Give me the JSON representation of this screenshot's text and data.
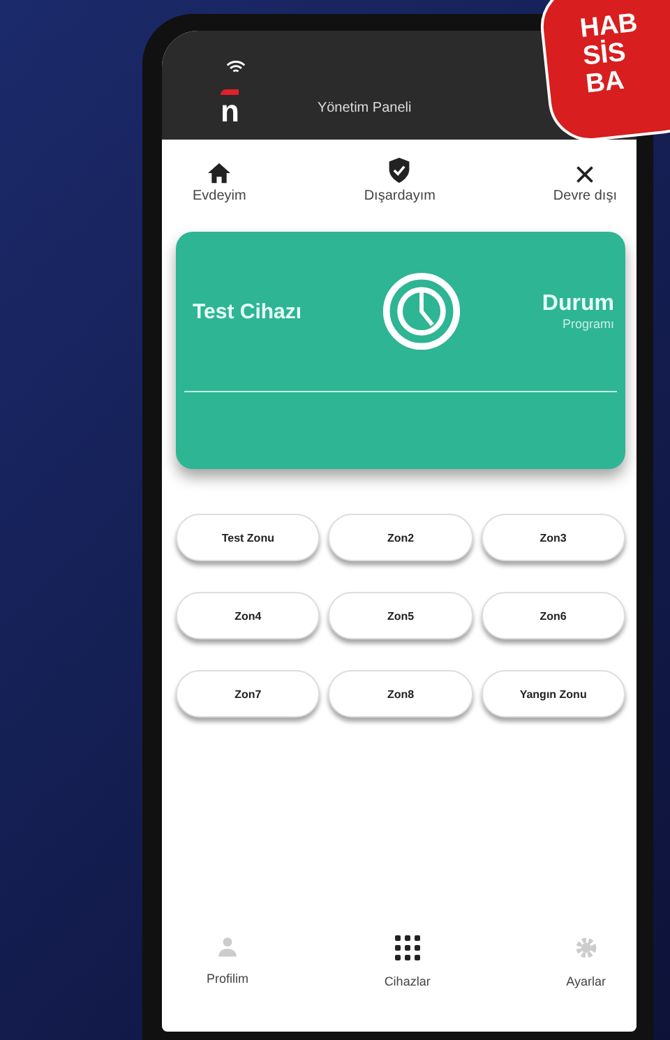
{
  "badge": {
    "lines": [
      "HAB",
      "SİS",
      "BA"
    ]
  },
  "header": {
    "logo": "n",
    "title": "Yönetim Paneli"
  },
  "modes": [
    {
      "label": "Evdeyim",
      "kind": "home"
    },
    {
      "label": "Dışardayım",
      "kind": "shield"
    },
    {
      "label": "Devre dışı",
      "kind": "close"
    }
  ],
  "device_card": {
    "name": "Test Cihazı",
    "status": "Durum",
    "status_detail": "Programı"
  },
  "zones": [
    "Test Zonu",
    "Zon2",
    "Zon3",
    "Zon4",
    "Zon5",
    "Zon6",
    "Zon7",
    "Zon8",
    "Yangın Zonu"
  ],
  "bottom_nav": [
    {
      "label": "Profilim",
      "kind": "person",
      "selected": false
    },
    {
      "label": "Cihazlar",
      "kind": "grid",
      "selected": true
    },
    {
      "label": "Ayarlar",
      "kind": "gear",
      "selected": false
    }
  ]
}
